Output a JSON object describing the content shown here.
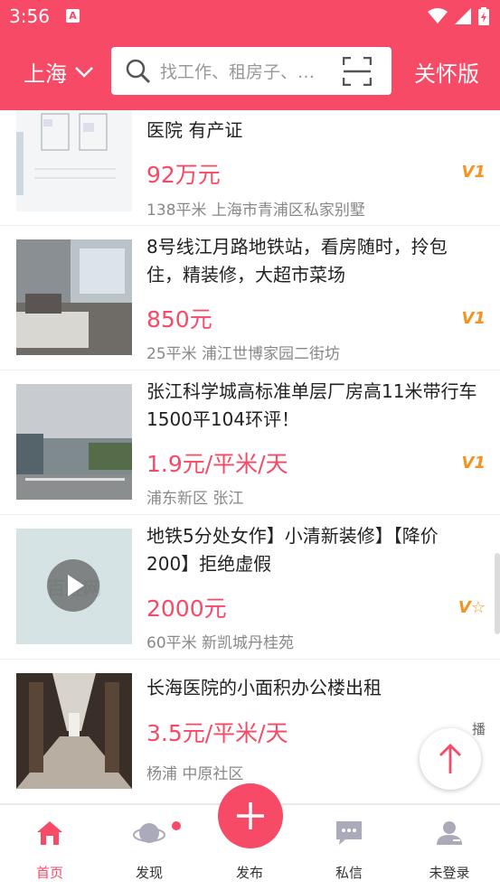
{
  "status_bar": {
    "time": "3:56",
    "notif_glyph": "A"
  },
  "header": {
    "city": "上海",
    "search_placeholder": "找工作、租房子、…",
    "care_mode": "关怀版"
  },
  "listings": [
    {
      "title": "一楼送帝花园二楼送阁楼 靠近吾泰龙 甲医院 有产证",
      "price": "92万元",
      "meta": "138平米 上海市青浦区私家别墅",
      "badge": "V1"
    },
    {
      "title": "8号线江月路地铁站，看房随时，拎包住，精装修，大超市菜场",
      "price": "850元",
      "meta": "25平米 浦江世博家园二街坊",
      "badge": "V1"
    },
    {
      "title": "张江科学城高标准单层厂房高11米带行车1500平104环评！",
      "price": "1.9元/平米/天",
      "meta": "浦东新区 张江",
      "badge": "V1"
    },
    {
      "title": "地铁5分处女作】小清新装修】【降价200】拒绝虚假",
      "price": "2000元",
      "meta": "60平米 新凯城丹桂苑",
      "badge": "V☆",
      "watermark": "百姓网"
    },
    {
      "title": "长海医院的小面积办公楼出租",
      "price": "3.5元/平米/天",
      "meta": "杨浦 中原社区",
      "badge": "播"
    }
  ],
  "bottom_nav": [
    {
      "label": "首页"
    },
    {
      "label": "发现"
    },
    {
      "label": "发布"
    },
    {
      "label": "私信"
    },
    {
      "label": "未登录"
    }
  ],
  "colors": {
    "accent": "#f64a66",
    "badge": "#f7921e"
  }
}
